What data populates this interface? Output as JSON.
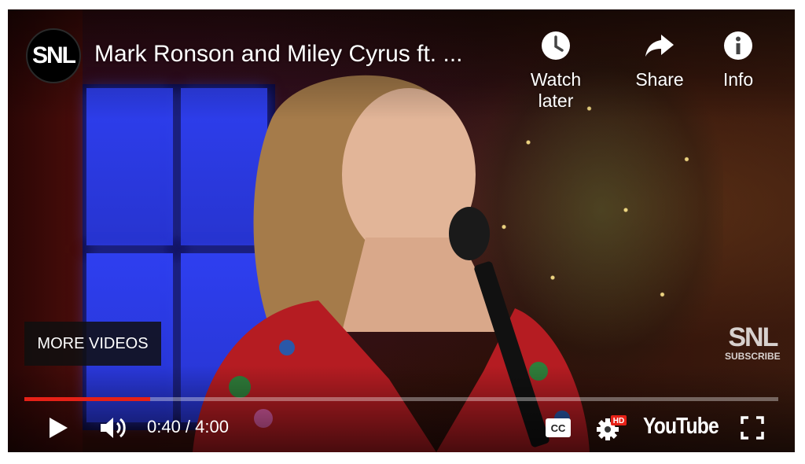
{
  "video": {
    "title": "Mark Ronson and Miley Cyrus ft. ...",
    "channel_logo_text": "SNL"
  },
  "top_actions": [
    {
      "label": "Watch later",
      "icon": "clock-icon"
    },
    {
      "label": "Share",
      "icon": "share-arrow-icon"
    },
    {
      "label": "Info",
      "icon": "info-icon"
    }
  ],
  "overlay": {
    "more_videos_label": "MORE VIDEOS",
    "watermark_logo": "SNL",
    "watermark_sub": "SUBSCRIBE"
  },
  "playback": {
    "current_time": "0:40",
    "duration": "4:00",
    "time_display": "0:40 / 4:00",
    "progress_fraction": 0.1667
  },
  "controls": {
    "play_icon": "play-icon",
    "volume_icon": "volume-icon",
    "cc_label": "CC",
    "settings_badge": "HD",
    "brand_label": "YouTube",
    "fullscreen_icon": "fullscreen-icon"
  },
  "colors": {
    "progress_played": "#e62117",
    "progress_track": "rgba(255,255,255,0.35)",
    "hd_badge": "#e62117"
  }
}
